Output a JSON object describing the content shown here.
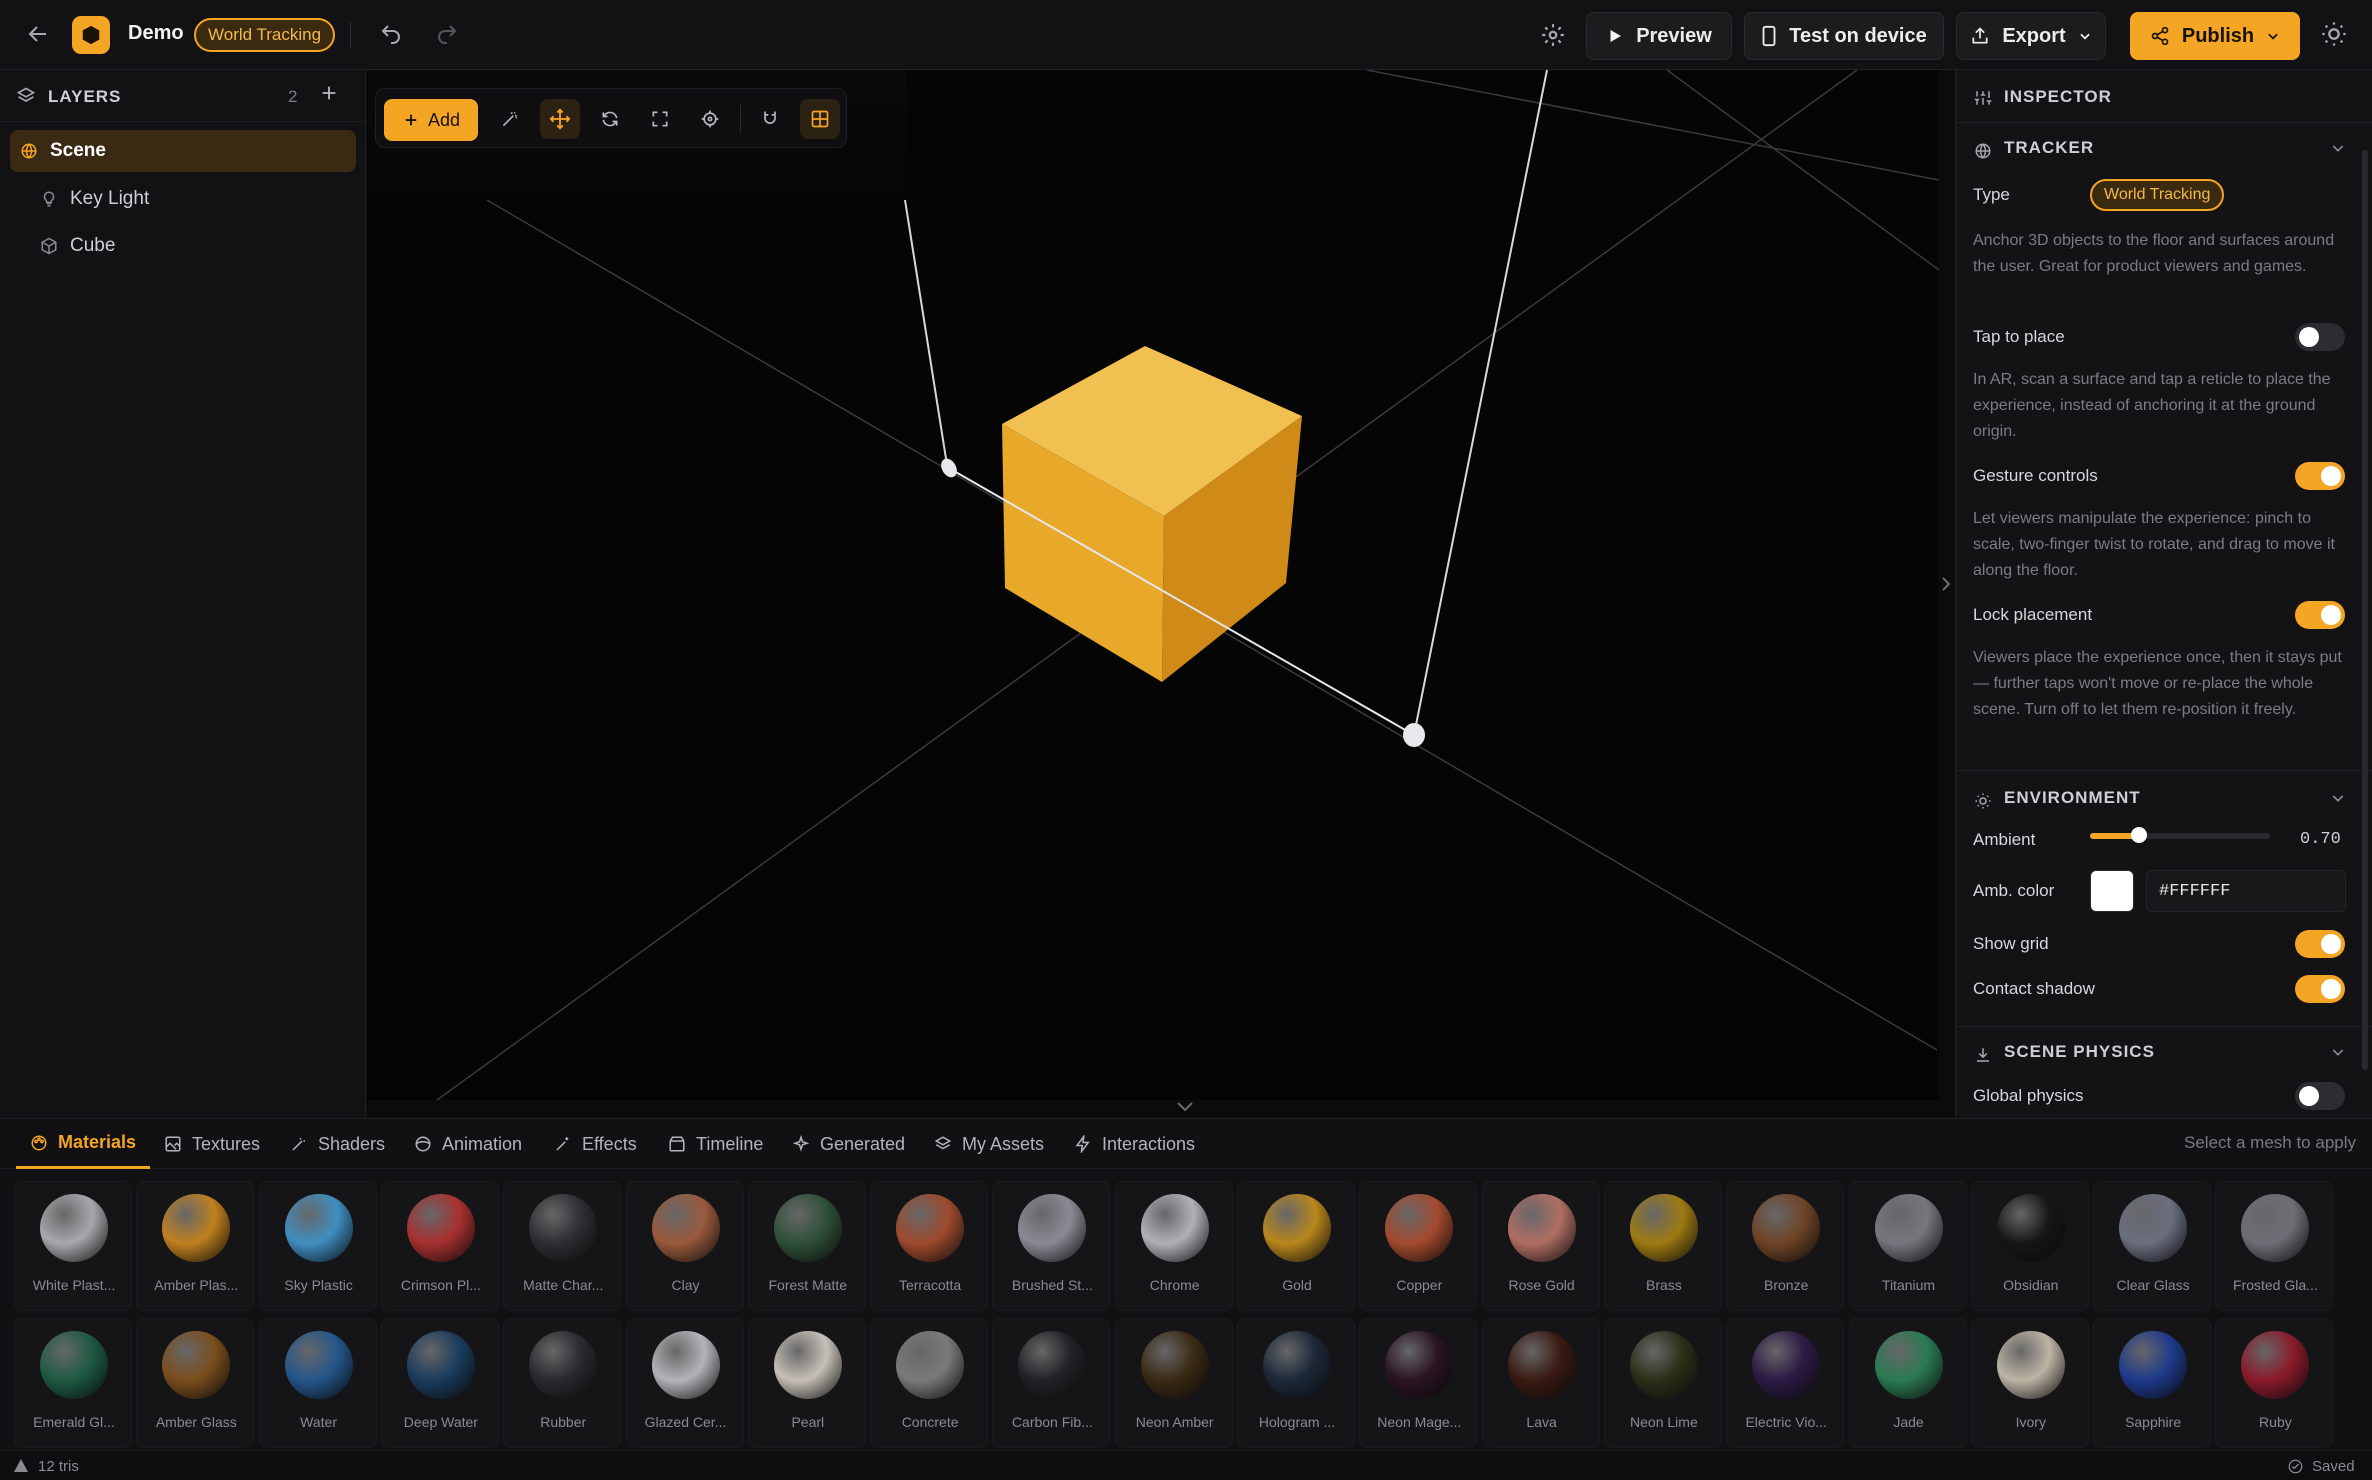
{
  "app": {
    "name": "Demo",
    "mode_badge": "World Tracking"
  },
  "toolbar": {
    "preview_label": "Preview",
    "test_label": "Test on device",
    "export_label": "Export",
    "publish_label": "Publish"
  },
  "layers": {
    "title": "LAYERS",
    "count": "2",
    "items": [
      {
        "label": "Scene",
        "icon": "globe-icon"
      },
      {
        "label": "Key Light",
        "icon": "bulb-icon"
      },
      {
        "label": "Cube",
        "icon": "cube-icon"
      }
    ]
  },
  "viewport": {
    "add_label": "Add",
    "accent": "#f5a524"
  },
  "inspector": {
    "title": "INSPECTOR",
    "tracker": {
      "title": "TRACKER",
      "type_label": "Type",
      "type_value": "World Tracking",
      "description": "Anchor 3D objects to the floor and surfaces around the user. Great for product viewers and games.",
      "tap_label": "Tap to place",
      "tap_on": false,
      "tap_help": "In AR, scan a surface and tap a reticle to place the experience, instead of anchoring it at the ground origin.",
      "gesture_label": "Gesture controls",
      "gesture_on": true,
      "gesture_help": "Let viewers manipulate the experience: pinch to scale, two-finger twist to rotate, and drag to move it along the floor.",
      "lock_label": "Lock placement",
      "lock_on": true,
      "lock_help": "Viewers place the experience once, then it stays put — further taps won't move or re-place the whole scene. Turn off to let them re-position it freely."
    },
    "environment": {
      "title": "ENVIRONMENT",
      "ambient_label": "Ambient",
      "ambient_value": "0.70",
      "ambient_fraction": 0.27,
      "amb_color_label": "Amb. color",
      "amb_color_value": "#FFFFFF",
      "grid_label": "Show grid",
      "grid_on": true,
      "shadow_label": "Contact shadow",
      "shadow_on": true
    },
    "physics": {
      "title": "SCENE PHYSICS",
      "global_label": "Global physics",
      "global_on": false
    }
  },
  "bottom": {
    "tabs": [
      "Materials",
      "Textures",
      "Shaders",
      "Animation",
      "Effects",
      "Timeline",
      "Generated",
      "My Assets",
      "Interactions"
    ],
    "active_tab": "Materials",
    "hint": "Select a mesh to apply",
    "materials": [
      {
        "name": "White Plast...",
        "color": "#a8a8ac"
      },
      {
        "name": "Amber Plas...",
        "color": "#c0801e"
      },
      {
        "name": "Sky Plastic",
        "color": "#3f8ec0"
      },
      {
        "name": "Crimson Pl...",
        "color": "#a83030"
      },
      {
        "name": "Matte Char...",
        "color": "#2e2e32"
      },
      {
        "name": "Clay",
        "color": "#9a5a3c"
      },
      {
        "name": "Forest Matte",
        "color": "#2e5038"
      },
      {
        "name": "Terracotta",
        "color": "#9e4a2c"
      },
      {
        "name": "Brushed St...",
        "color": "#8a8a94"
      },
      {
        "name": "Chrome",
        "color": "#b0b0b6"
      },
      {
        "name": "Gold",
        "color": "#b8861c"
      },
      {
        "name": "Copper",
        "color": "#a44a2e"
      },
      {
        "name": "Rose Gold",
        "color": "#b06e62"
      },
      {
        "name": "Brass",
        "color": "#9e7a12"
      },
      {
        "name": "Bronze",
        "color": "#6e4426"
      },
      {
        "name": "Titanium",
        "color": "#76767e"
      },
      {
        "name": "Obsidian",
        "color": "#161618"
      },
      {
        "name": "Clear Glass",
        "color": "#6a6e7e"
      },
      {
        "name": "Frosted Gla...",
        "color": "#6e6e76"
      },
      {
        "name": "Emerald Gl...",
        "color": "#1e5a42"
      },
      {
        "name": "Amber Glass",
        "color": "#7a4e1c"
      },
      {
        "name": "Water",
        "color": "#24568a"
      },
      {
        "name": "Deep Water",
        "color": "#1a3c5c"
      },
      {
        "name": "Rubber",
        "color": "#2a2a2e"
      },
      {
        "name": "Glazed Cer...",
        "color": "#b4b4b8"
      },
      {
        "name": "Pearl",
        "color": "#c6c0b8"
      },
      {
        "name": "Concrete",
        "color": "#7a7a7c"
      },
      {
        "name": "Carbon Fib...",
        "color": "#222226"
      },
      {
        "name": "Neon Amber",
        "color": "#3a2a14"
      },
      {
        "name": "Hologram ...",
        "color": "#1c2838"
      },
      {
        "name": "Neon Mage...",
        "color": "#2a1420"
      },
      {
        "name": "Lava",
        "color": "#3a1a12"
      },
      {
        "name": "Neon Lime",
        "color": "#2a3018"
      },
      {
        "name": "Electric Vio...",
        "color": "#2c1a44"
      },
      {
        "name": "Jade",
        "color": "#2a7a52"
      },
      {
        "name": "Ivory",
        "color": "#bcb4a4"
      },
      {
        "name": "Sapphire",
        "color": "#1e3a8a"
      },
      {
        "name": "Ruby",
        "color": "#8a1a2a"
      }
    ]
  },
  "status": {
    "tris": "12 tris",
    "saved": "Saved"
  }
}
